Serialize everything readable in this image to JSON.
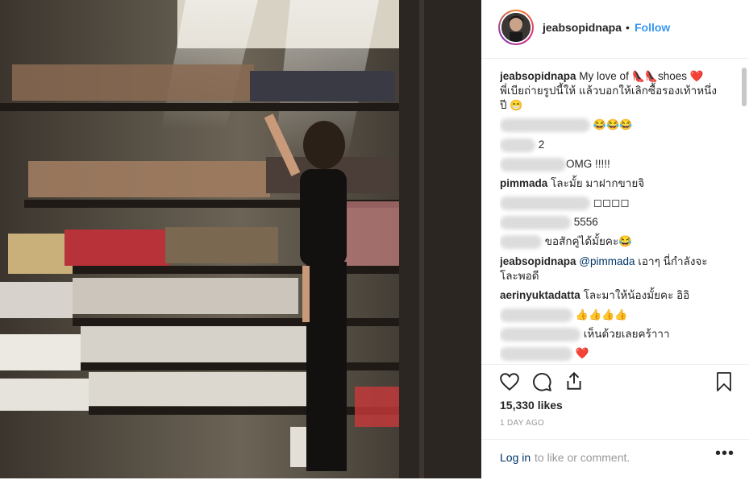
{
  "post": {
    "username": "jeabsopidnapa",
    "follow_label": "Follow",
    "dot": "•"
  },
  "caption": {
    "username": "jeabsopidnapa",
    "text_before": "My love of ",
    "text_shoes": "shoes",
    "line2": "พี่เบียถ่ายรูปนี้ให้ แล้วบอกให้เลิกซื้อรองเท้าหนึ่ง",
    "line3": "ปี"
  },
  "comments": [
    {
      "text": "😂😂😂"
    },
    {
      "text": "2"
    },
    {
      "text": "OMG !!!!!"
    },
    {
      "username": "pimmada",
      "text": "โละมั้ย มาฝากขายจิ"
    },
    {
      "text": "◻◻◻◻"
    },
    {
      "text": "5556"
    },
    {
      "text": "ขอสักคู่ได้มั้ยคะ😂"
    },
    {
      "username": "jeabsopidnapa",
      "mention": "@pimmada",
      "text": " เอาๆ นี่กำลังจะ",
      "text2": "โละพอดี"
    },
    {
      "username": "aerinyuktadatta",
      "text": "โละมาให้น้องมั้ยคะ อิอิ"
    },
    {
      "text": "👍👍👍👍"
    },
    {
      "text": "เห็นด้วยเลยคร้าาา"
    },
    {
      "text": "❤️"
    }
  ],
  "likes": "15,330 likes",
  "date": "1 DAY AGO",
  "login": {
    "link": "Log in",
    "rest": "to like or comment."
  },
  "more": "•••",
  "icons": [
    "heart-icon",
    "comment-icon",
    "share-icon",
    "bookmark-icon",
    "more-icon"
  ],
  "colors": {
    "link_blue": "#3897f0",
    "mention_blue": "#003569",
    "heart_red": "#ed4956",
    "meta_gray": "#999999"
  }
}
